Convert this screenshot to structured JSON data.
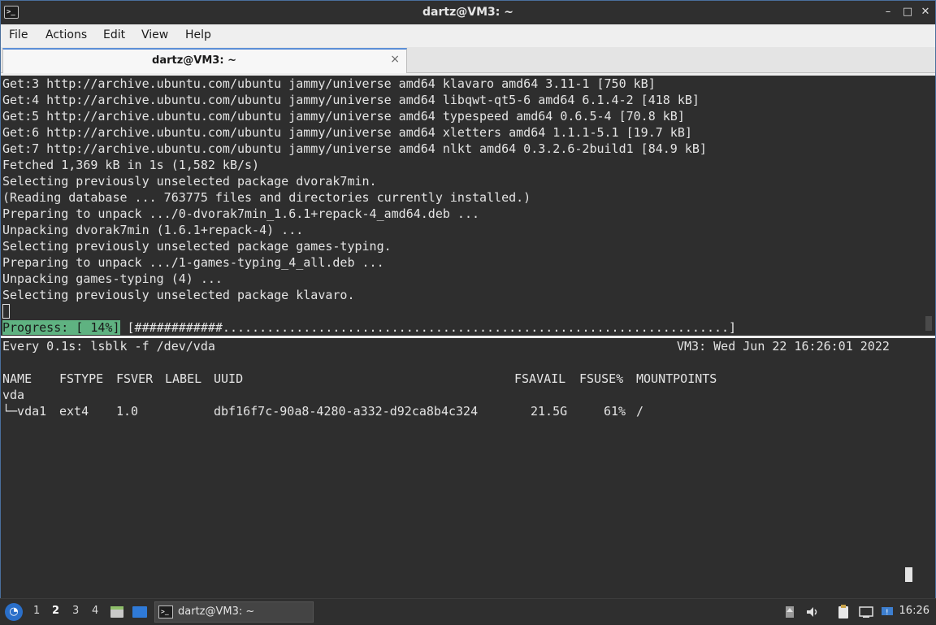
{
  "window": {
    "title": "dartz@VM3: ~",
    "app_icon": ">_",
    "controls": {
      "minimize": "–",
      "maximize": "□",
      "close": "✕"
    }
  },
  "menu": [
    "File",
    "Actions",
    "Edit",
    "View",
    "Help"
  ],
  "tab": {
    "label": "dartz@VM3: ~",
    "close": "×"
  },
  "pane1": {
    "lines": [
      "Get:3 http://archive.ubuntu.com/ubuntu jammy/universe amd64 klavaro amd64 3.11-1 [750 kB]",
      "Get:4 http://archive.ubuntu.com/ubuntu jammy/universe amd64 libqwt-qt5-6 amd64 6.1.4-2 [418 kB]",
      "Get:5 http://archive.ubuntu.com/ubuntu jammy/universe amd64 typespeed amd64 0.6.5-4 [70.8 kB]",
      "Get:6 http://archive.ubuntu.com/ubuntu jammy/universe amd64 xletters amd64 1.1.1-5.1 [19.7 kB]",
      "Get:7 http://archive.ubuntu.com/ubuntu jammy/universe amd64 nlkt amd64 0.3.2.6-2build1 [84.9 kB]",
      "Fetched 1,369 kB in 1s (1,582 kB/s)",
      "Selecting previously unselected package dvorak7min.",
      "(Reading database ... 763775 files and directories currently installed.)",
      "Preparing to unpack .../0-dvorak7min_1.6.1+repack-4_amd64.deb ...",
      "Unpacking dvorak7min (1.6.1+repack-4) ...",
      "Selecting previously unselected package games-typing.",
      "Preparing to unpack .../1-games-typing_4_all.deb ...",
      "Unpacking games-typing (4) ...",
      "Selecting previously unselected package klavaro."
    ],
    "progress_label": "Progress: [ 14%]",
    "progress_bar": " [############.....................................................................]",
    "progress_fraction": 0.14
  },
  "pane2": {
    "header_left": "Every 0.1s: lsblk -f /dev/vda",
    "header_right": "VM3: Wed Jun 22 16:26:01 2022",
    "columns": [
      "NAME",
      "FSTYPE",
      "FSVER",
      "LABEL",
      "UUID",
      "FSAVAIL",
      "FSUSE%",
      "MOUNTPOINTS"
    ],
    "rows": [
      {
        "name": "vda",
        "fstype": "",
        "fsver": "",
        "label": "",
        "uuid": "",
        "fsavail": "",
        "fsuse": "",
        "mount": ""
      },
      {
        "name": "└─vda1",
        "fstype": "ext4",
        "fsver": "1.0",
        "label": "",
        "uuid": "dbf16f7c-90a8-4280-a332-d92ca8b4c324",
        "fsavail": "21.5G",
        "fsuse": "61%",
        "mount": "/"
      }
    ]
  },
  "taskbar": {
    "start_icon": "start-menu-icon",
    "workspaces": [
      "1",
      "2",
      "3",
      "4"
    ],
    "active_workspace": "2",
    "task_label": "dartz@VM3: ~",
    "clock": "16:26"
  }
}
